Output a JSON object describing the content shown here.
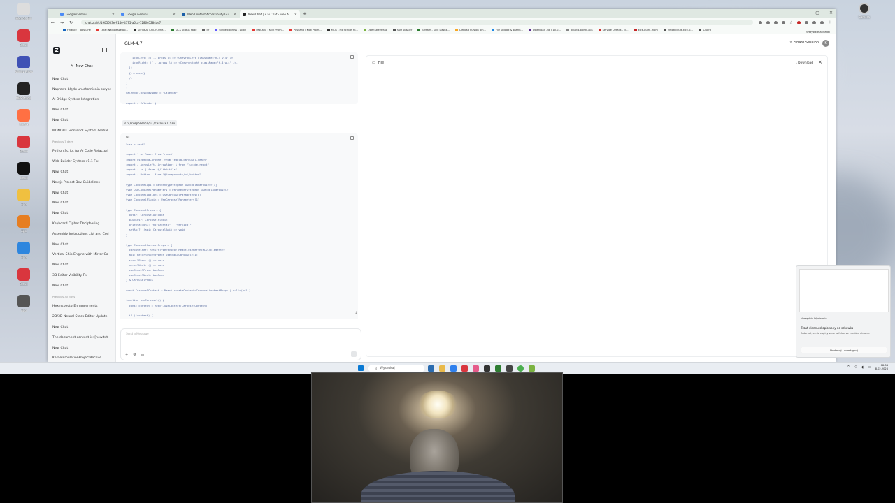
{
  "desktop": {
    "left_icons": [
      "Recycle Bin",
      "Brave",
      "Affinity Photo",
      "OBS Studio",
      "Firefox",
      "Brave",
      "Steam",
      "App",
      "App",
      "App",
      "Brave",
      "App"
    ],
    "right_icon": "Camera"
  },
  "browser": {
    "tabs": [
      {
        "label": "Google Gemini",
        "color": "#4c8bf5",
        "active": false
      },
      {
        "label": "Google Gemini",
        "color": "#4c8bf5",
        "active": false
      },
      {
        "label": "Web Content Accessibility Gui...",
        "color": "#1b5fa8",
        "active": false
      },
      {
        "label": "New Chat | Z.ai Chat - Free AI ...",
        "color": "#222",
        "active": true
      }
    ],
    "url": "chat.z.ai/c/1905603e-914e-4775-a6ca-7286e5284ae7",
    "bookmarks": [
      {
        "label": "Finance | Tops.Line",
        "color": "#1565c0"
      },
      {
        "label": "(346) Najnowsze po...",
        "color": "#e53935"
      },
      {
        "label": "Script-AI | All-in-One...",
        "color": "#333"
      },
      {
        "label": "KICK Status Page",
        "color": "#2e7d32"
      },
      {
        "label": "dr",
        "color": "#666"
      },
      {
        "label": "Stripe Express - Login",
        "color": "#635bff"
      },
      {
        "label": "Pasuana | Kick Prom...",
        "color": "#e53935"
      },
      {
        "label": "Pasuana | Kick Prom...",
        "color": "#e53935"
      },
      {
        "label": "MOX - Fix Scripts fo...",
        "color": "#333"
      },
      {
        "label": "OpenStreetMap",
        "color": "#7cb342"
      },
      {
        "label": "surf upsaler",
        "color": "#555"
      },
      {
        "label": "Stream - Kick Dashb...",
        "color": "#2e7d32"
      },
      {
        "label": "Deposit PLN on Bin...",
        "color": "#f9a825"
      },
      {
        "label": "File upload & sharin...",
        "color": "#1e88e5"
      },
      {
        "label": "Download .NET 10.0...",
        "color": "#5c2d91"
      },
      {
        "label": "aj.jakis-polski.aps",
        "color": "#888"
      },
      {
        "label": "Service Details - Ti...",
        "color": "#d32f2f"
      },
      {
        "label": "kick-auth - npm",
        "color": "#c62828"
      },
      {
        "label": "@botkick/js-kick.p...",
        "color": "#555"
      },
      {
        "label": "K-word",
        "color": "#555"
      }
    ],
    "bookmarks_all": "Wszystkie zakładki"
  },
  "app": {
    "model_name": "GLM-4.7",
    "new_chat": "New Chat",
    "share": "Share Session",
    "avatar_initial": "K",
    "history": [
      {
        "type": "item",
        "label": "New Chat"
      },
      {
        "type": "item",
        "label": "Naprawa błędu uruchomienia skrypt"
      },
      {
        "type": "item",
        "label": "AI Bridge System Integration"
      },
      {
        "type": "item",
        "label": "New Chat"
      },
      {
        "type": "item",
        "label": "New Chat"
      },
      {
        "type": "item",
        "label": "MONOLIT Frontend: System Global"
      },
      {
        "type": "section",
        "label": "Previous 7 days"
      },
      {
        "type": "item",
        "label": "Python Script for AI Code Refactori"
      },
      {
        "type": "item",
        "label": "Web Builder System v1.1 Fix"
      },
      {
        "type": "item",
        "label": "New Chat"
      },
      {
        "type": "item",
        "label": "Nextjs Project Dev Guidelines"
      },
      {
        "type": "item",
        "label": "New Chat"
      },
      {
        "type": "item",
        "label": "New Chat"
      },
      {
        "type": "item",
        "label": "New Chat"
      },
      {
        "type": "item",
        "label": "Keyboard Cipher Deciphering"
      },
      {
        "type": "item",
        "label": "Assembly Instructions List and Cod"
      },
      {
        "type": "item",
        "label": "New Chat"
      },
      {
        "type": "item",
        "label": "Vertical Ship Engine with Mirror Co"
      },
      {
        "type": "item",
        "label": "New Chat"
      },
      {
        "type": "item",
        "label": "3D Editor Visibility Fix"
      },
      {
        "type": "item",
        "label": "New Chat"
      },
      {
        "type": "section",
        "label": "Previous 30 days"
      },
      {
        "type": "item",
        "label": "HexInspectorEnhancements"
      },
      {
        "type": "item",
        "label": "2D/3D Neural Stack Editor Update"
      },
      {
        "type": "item",
        "label": "New Chat"
      },
      {
        "type": "item",
        "label": "The document content is: [new.txt:"
      },
      {
        "type": "item",
        "label": "New Chat"
      },
      {
        "type": "item",
        "label": "KernelEmulationProjectRecove"
      }
    ],
    "code_top": "    iconLeft: ({ ...props }) => <ChevronLeft className=\"h-4 w-4\" />,\n    iconRight: ({ ...props }) => <ChevronRight className=\"h-4 w-4\" />,\n  }}\n  {...props}\n  />\n)\n}\nCalendar.displayName = \"Calendar\"\n\nexport { Calendar }",
    "file_name": "src/components/ui/carousel.tsx",
    "code_lang": "tsx",
    "code_main": "\"use client\"\n\nimport * as React from \"react\"\nimport useEmblaCarousel from \"embla-carousel-react\"\nimport { ArrowLeft, ArrowRight } from \"lucide-react\"\nimport { cn } from \"@/lib/utils\"\nimport { Button } from \"@/components/ui/button\"\n\ntype CarouselApi = ReturnType<typeof useEmblaCarousel>[1]\ntype UseCarouselParameters = Parameters<typeof useEmblaCarousel>\ntype CarouselOptions = UseCarouselParameters[0]\ntype CarouselPlugin = UseCarouselParameters[1]\n\ntype CarouselProps = {\n  opts?: CarouselOptions\n  plugins?: CarouselPlugin\n  orientation?: \"horizontal\" | \"vertical\"\n  setApi?: (api: CarouselApi) => void\n}\n\ntype CarouselContextProps = {\n  carouselRef: ReturnType<typeof React.useRef<HTMLDivElement>>\n  api: ReturnType<typeof useEmblaCarousel>[1]\n  scrollPrev: () => void\n  scrollNext: () => void\n  canScrollPrev: boolean\n  canScrollNext: boolean\n} & CarouselProps\n\nconst CarouselContext = React.createContext<CarouselContextProps | null>(null)\n\nfunction useCarousel() {\n  const context = React.useContext(CarouselContext)\n\n  if (!context) {",
    "input_placeholder": "Send a Message",
    "panel_title": "File",
    "panel_download": "Download"
  },
  "notification": {
    "app": "Narzędzie Wycinanie",
    "title": "Zrzut ekranu skopiowany do schowka",
    "body": "Automatycznie zapisywane w folderze zrzutów ekranu.",
    "button": "Dostosuj i udostępnij"
  },
  "taskbar": {
    "search_placeholder": "Wyszukaj",
    "time": "08:34",
    "date": "8.02.2026"
  }
}
